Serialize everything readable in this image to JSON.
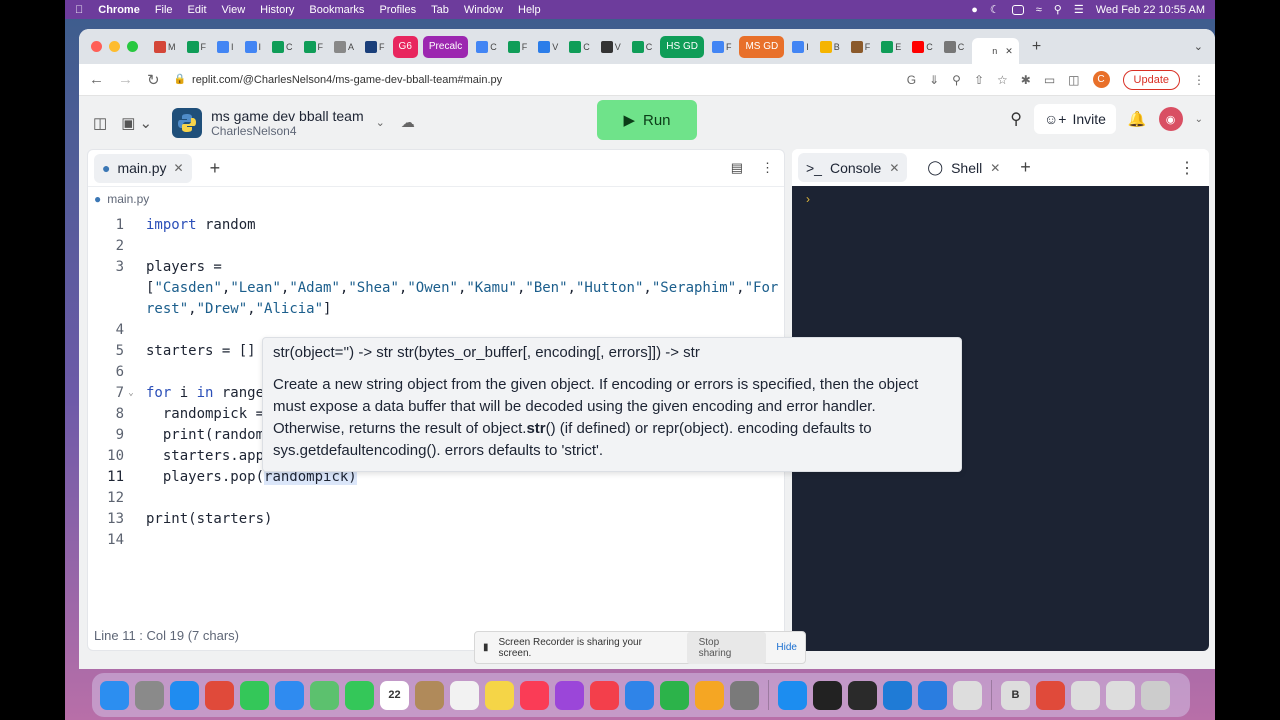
{
  "menubar": {
    "app": "Chrome",
    "items": [
      "File",
      "Edit",
      "View",
      "History",
      "Bookmarks",
      "Profiles",
      "Tab",
      "Window",
      "Help"
    ],
    "datetime": "Wed Feb 22  10:55 AM"
  },
  "browser": {
    "tabs": [
      {
        "label": "M",
        "color": "#d44638"
      },
      {
        "label": "F",
        "color": "#0f9d58"
      },
      {
        "label": "I",
        "color": "#4285f4"
      },
      {
        "label": "I",
        "color": "#4285f4"
      },
      {
        "label": "C",
        "color": "#0f9d58"
      },
      {
        "label": "F",
        "color": "#0f9d58"
      },
      {
        "label": "A",
        "color": "#888888"
      },
      {
        "label": "F",
        "color": "#1a3f7a"
      },
      {
        "label": "G6",
        "color": "#e8265e",
        "pill": true
      },
      {
        "label": "Precalc",
        "color": "#9c27b0",
        "pill": true
      },
      {
        "label": "C",
        "color": "#4285f4"
      },
      {
        "label": "F",
        "color": "#0f9d58"
      },
      {
        "label": "V",
        "color": "#2b7de9"
      },
      {
        "label": "C",
        "color": "#0f9d58"
      },
      {
        "label": "V",
        "color": "#333333"
      },
      {
        "label": "C",
        "color": "#0f9d58"
      },
      {
        "label": "HS GD",
        "color": "#0f9d58",
        "pill": true
      },
      {
        "label": "F",
        "color": "#4285f4"
      },
      {
        "label": "MS GD",
        "color": "#e8702a",
        "pill": true
      },
      {
        "label": "I",
        "color": "#4285f4"
      },
      {
        "label": "B",
        "color": "#f5b400"
      },
      {
        "label": "F",
        "color": "#8b5a2b"
      },
      {
        "label": "E",
        "color": "#0f9d58"
      },
      {
        "label": "C",
        "color": "#ff0000"
      },
      {
        "label": "C",
        "color": "#777777"
      },
      {
        "label": "n",
        "color": "#ffffff",
        "active": true
      }
    ],
    "url": "replit.com/@CharlesNelson4/ms-game-dev-bball-team#main.py",
    "update_label": "Update",
    "profile_initial": "C"
  },
  "replit": {
    "project_title": "ms game dev bball team",
    "project_owner": "CharlesNelson4",
    "run_label": "Run",
    "invite_label": "Invite",
    "editor_tab": "main.py",
    "breadcrumb": "main.py",
    "code_lines": [
      {
        "n": "1",
        "html": "<span class='kw'>import</span> random"
      },
      {
        "n": "2",
        "html": ""
      },
      {
        "n": "3",
        "html": "players ="
      },
      {
        "n": "",
        "html": "[<span class='str'>\"Casden\"</span>,<span class='str'>\"Lean\"</span>,<span class='str'>\"Adam\"</span>,<span class='str'>\"Shea\"</span>,<span class='str'>\"Owen\"</span>,<span class='str'>\"Kamu\"</span>,<span class='str'>\"Ben\"</span>,<span class='str'>\"Hutton\"</span>,<span class='str'>\"Seraphim\"</span>,<span class='str'>\"For</span>"
      },
      {
        "n": "",
        "html": "<span class='str'>rest\"</span>,<span class='str'>\"Drew\"</span>,<span class='str'>\"Alicia\"</span>]"
      },
      {
        "n": "4",
        "html": ""
      },
      {
        "n": "5",
        "html": "starters = []"
      },
      {
        "n": "6",
        "html": ""
      },
      {
        "n": "7",
        "html": "<span class='kw'>for</span> i <span class='kw'>in</span> range",
        "fold": true
      },
      {
        "n": "8",
        "html": "  randompick ="
      },
      {
        "n": "9",
        "html": "  print(random"
      },
      {
        "n": "10",
        "html": "  starters.app"
      },
      {
        "n": "11",
        "html": "  players.pop(<span class='hl'>randompick)</span>",
        "current": true
      },
      {
        "n": "12",
        "html": ""
      },
      {
        "n": "13",
        "html": "print(starters)"
      },
      {
        "n": "14",
        "html": ""
      }
    ],
    "tooltip": {
      "signature": "str(object='') -> str str(bytes_or_buffer[, encoding[, errors]]) -> str",
      "doc_before": "Create a new string object from the given object. If encoding or errors is specified, then the object must expose a data buffer that will be decoded using the given encoding and error handler. Otherwise, returns the result of object.",
      "doc_bold": "str",
      "doc_after": "() (if defined) or repr(object). encoding defaults to sys.getdefaultencoding(). errors defaults to 'strict'."
    },
    "status": "Line 11 : Col 19 (7 chars)",
    "console_tab": "Console",
    "shell_tab": "Shell",
    "console_prompt": "›"
  },
  "screen_share": {
    "message": "Screen Recorder is sharing your screen.",
    "stop_label": "Stop sharing",
    "hide_label": "Hide"
  },
  "dock": {
    "icons": [
      {
        "name": "finder-icon",
        "color": "#2c8ef0"
      },
      {
        "name": "launchpad-icon",
        "color": "#8a8a8a"
      },
      {
        "name": "safari-icon",
        "color": "#1f8cf0"
      },
      {
        "name": "chrome-icon",
        "color": "#e04a3a"
      },
      {
        "name": "messages-icon",
        "color": "#34c759"
      },
      {
        "name": "mail-icon",
        "color": "#2f8bf0"
      },
      {
        "name": "maps-icon",
        "color": "#5cc16e"
      },
      {
        "name": "facetime-icon",
        "color": "#34c759"
      },
      {
        "name": "calendar-icon",
        "color": "#ffffff",
        "text": "22"
      },
      {
        "name": "contacts-icon",
        "color": "#b08a5a"
      },
      {
        "name": "reminders-icon",
        "color": "#f2f2f2"
      },
      {
        "name": "notes-icon",
        "color": "#f5d547"
      },
      {
        "name": "music-icon",
        "color": "#fa3c56"
      },
      {
        "name": "podcasts-icon",
        "color": "#9b46d9"
      },
      {
        "name": "news-icon",
        "color": "#f33f4b"
      },
      {
        "name": "keynote-icon",
        "color": "#2f84e8"
      },
      {
        "name": "numbers-icon",
        "color": "#2cb34a"
      },
      {
        "name": "pages-icon",
        "color": "#f5a623"
      },
      {
        "name": "system-settings-icon",
        "color": "#7a7a7a"
      },
      {
        "name": "app-store-icon",
        "color": "#1c8df0"
      },
      {
        "name": "terminal-icon",
        "color": "#222222"
      },
      {
        "name": "activity-monitor-icon",
        "color": "#2a2a2a"
      },
      {
        "name": "vscode-icon",
        "color": "#1f7bd6"
      },
      {
        "name": "xcode-icon",
        "color": "#2a7de0"
      },
      {
        "name": "preview-icon",
        "color": "#dddddd"
      },
      {
        "name": "bbedit-icon",
        "color": "#dddddd",
        "text": "B"
      },
      {
        "name": "chrome-app-icon",
        "color": "#e04a3a"
      },
      {
        "name": "document-icon",
        "color": "#dddddd"
      },
      {
        "name": "document-2-icon",
        "color": "#dddddd"
      },
      {
        "name": "trash-icon",
        "color": "#cccccc"
      }
    ]
  }
}
